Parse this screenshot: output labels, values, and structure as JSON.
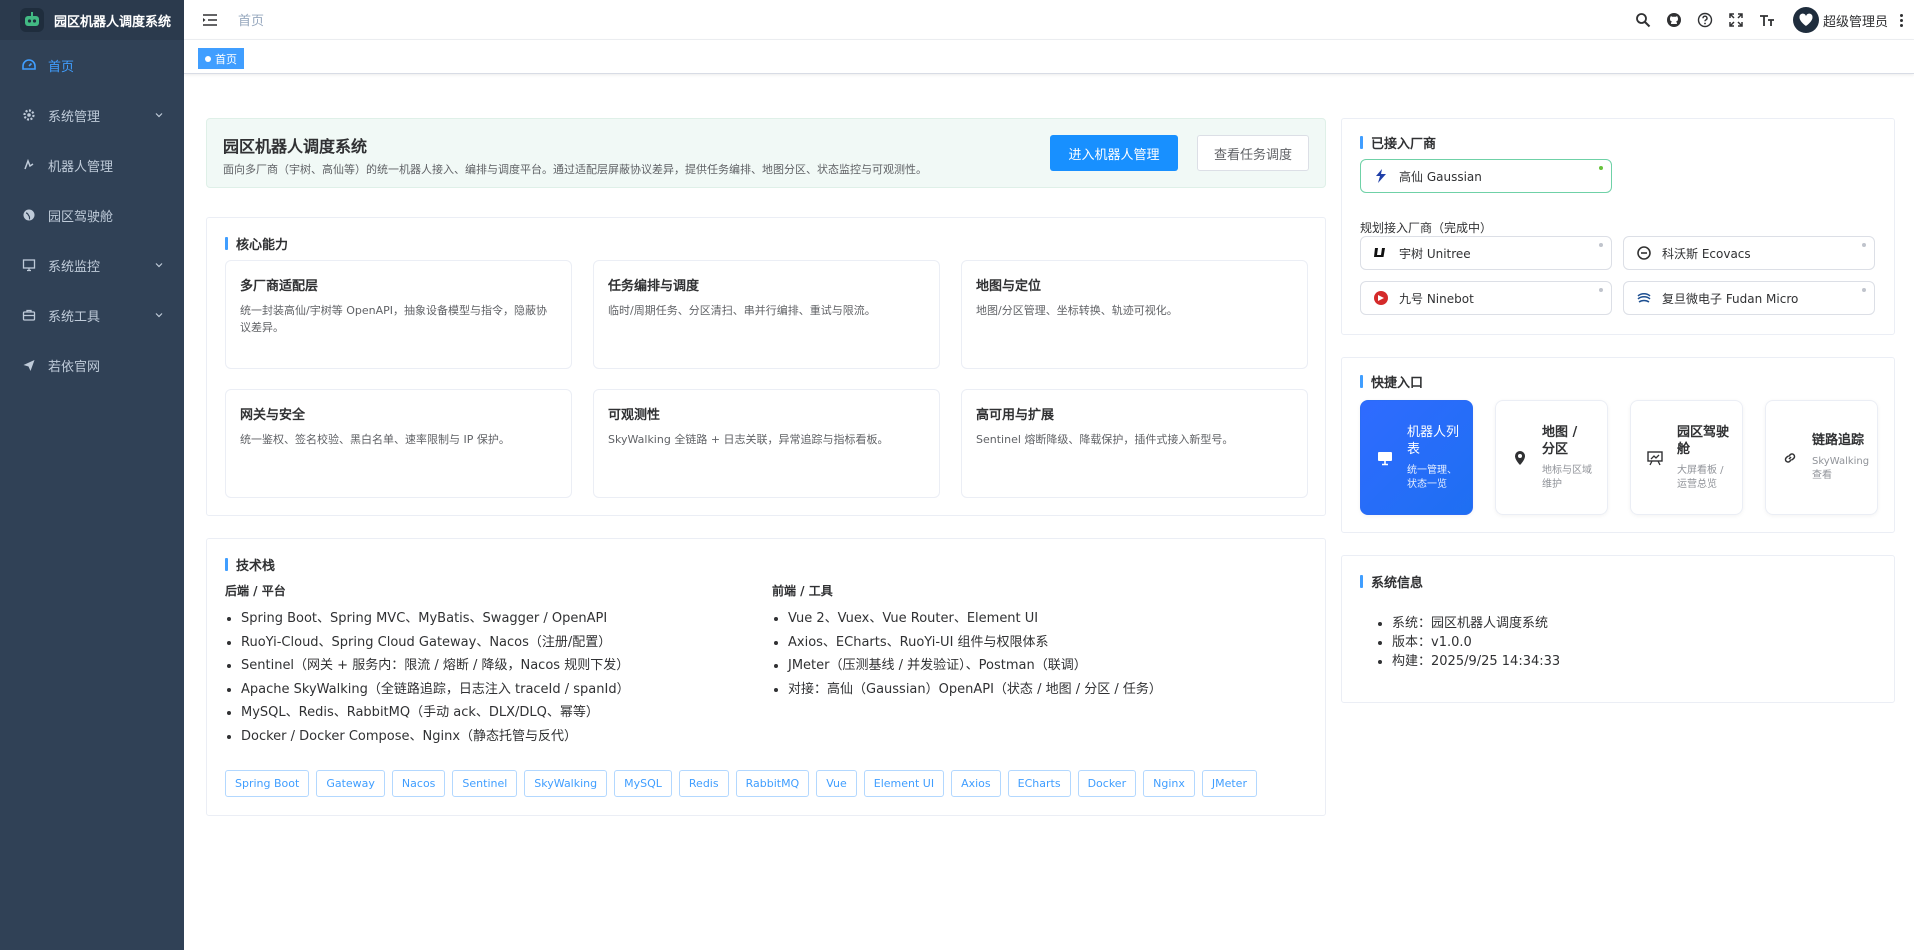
{
  "app": {
    "title": "园区机器人调度系统"
  },
  "sidebar": {
    "items": [
      {
        "label": "首页",
        "icon": "dashboard-icon",
        "active": true
      },
      {
        "label": "系统管理",
        "icon": "gear-icon",
        "has_children": true
      },
      {
        "label": "机器人管理",
        "icon": "robot-icon"
      },
      {
        "label": "园区驾驶舱",
        "icon": "globe-icon"
      },
      {
        "label": "系统监控",
        "icon": "monitor-icon",
        "has_children": true
      },
      {
        "label": "系统工具",
        "icon": "toolbox-icon",
        "has_children": true
      },
      {
        "label": "若依官网",
        "icon": "send-icon"
      }
    ]
  },
  "navbar": {
    "breadcrumb": "首页",
    "user_name": "超级管理员",
    "icons": [
      "search-icon",
      "github-icon",
      "help-icon",
      "fullscreen-icon",
      "font-size-icon"
    ]
  },
  "tags": {
    "active": "首页"
  },
  "hero": {
    "title": "园区机器人调度系统",
    "desc": "面向多厂商（宇树、高仙等）的统一机器人接入、编排与调度平台。通过适配层屏蔽协议差异，提供任务编排、地图分区、状态监控与可观测性。",
    "primary_btn": "进入机器人管理",
    "secondary_btn": "查看任务调度"
  },
  "core": {
    "title": "核心能力",
    "features": [
      {
        "title": "多厂商适配层",
        "desc": "统一封装高仙/宇树等 OpenAPI，抽象设备模型与指令，隐蔽协议差异。"
      },
      {
        "title": "任务编排与调度",
        "desc": "临时/周期任务、分区清扫、串并行编排、重试与限流。"
      },
      {
        "title": "地图与定位",
        "desc": "地图/分区管理、坐标转换、轨迹可视化。"
      },
      {
        "title": "网关与安全",
        "desc": "统一鉴权、签名校验、黑白名单、速率限制与 IP 保护。"
      },
      {
        "title": "可观测性",
        "desc": "SkyWalking 全链路 + 日志关联，异常追踪与指标看板。"
      },
      {
        "title": "高可用与扩展",
        "desc": "Sentinel 熔断降级、降载保护，插件式接入新型号。"
      }
    ]
  },
  "tech": {
    "title": "技术栈",
    "backend_title": "后端 / 平台",
    "backend": [
      "Spring Boot、Spring MVC、MyBatis、Swagger / OpenAPI",
      "RuoYi-Cloud、Spring Cloud Gateway、Nacos（注册/配置）",
      "Sentinel（网关 + 服务内：限流 / 熔断 / 降级，Nacos 规则下发）",
      "Apache SkyWalking（全链路追踪，日志注入 traceId / spanId）",
      "MySQL、Redis、RabbitMQ（手动 ack、DLX/DLQ、幂等）",
      "Docker / Docker Compose、Nginx（静态托管与反代）"
    ],
    "frontend_title": "前端 / 工具",
    "frontend": [
      "Vue 2、Vuex、Vue Router、Element UI",
      "Axios、ECharts、RuoYi-UI 组件与权限体系",
      "JMeter（压测基线 / 并发验证）、Postman（联调）",
      "对接：高仙（Gaussian）OpenAPI（状态 / 地图 / 分区 / 任务）"
    ],
    "pills": [
      "Spring Boot",
      "Gateway",
      "Nacos",
      "Sentinel",
      "SkyWalking",
      "MySQL",
      "Redis",
      "RabbitMQ",
      "Vue",
      "Element UI",
      "Axios",
      "ECharts",
      "Docker",
      "Nginx",
      "JMeter"
    ]
  },
  "vendors": {
    "title": "已接入厂商",
    "connected": [
      {
        "name": "高仙 Gaussian",
        "icon": "gaussian-logo-icon"
      }
    ],
    "planned_label": "规划接入厂商（完成中）",
    "planned": [
      {
        "name": "宇树 Unitree",
        "icon": "unitree-logo-icon"
      },
      {
        "name": "科沃斯 Ecovacs",
        "icon": "ecovacs-logo-icon"
      },
      {
        "name": "九号 Ninebot",
        "icon": "ninebot-logo-icon"
      },
      {
        "name": "复旦微电子 Fudan Micro",
        "icon": "fudan-logo-icon"
      }
    ]
  },
  "quick": {
    "title": "快捷入口",
    "items": [
      {
        "title": "机器人列表",
        "desc": "统一管理、状态一览",
        "icon": "monitor-icon"
      },
      {
        "title": "地图 / 分区",
        "desc": "地标与区域维护",
        "icon": "location-icon"
      },
      {
        "title": "园区驾驶舱",
        "desc": "大屏看板 / 运营总览",
        "icon": "dashboard-screen-icon"
      },
      {
        "title": "链路追踪",
        "desc": "SkyWalking 查看",
        "icon": "link-icon"
      }
    ]
  },
  "sysinfo": {
    "title": "系统信息",
    "items": [
      "系统：园区机器人调度系统",
      "版本：v1.0.0",
      "构建：2025/9/25 14:34:33"
    ]
  },
  "colors": {
    "sidebar_bg": "#304156",
    "primary": "#1890ff",
    "active_menu": "#409eff"
  }
}
